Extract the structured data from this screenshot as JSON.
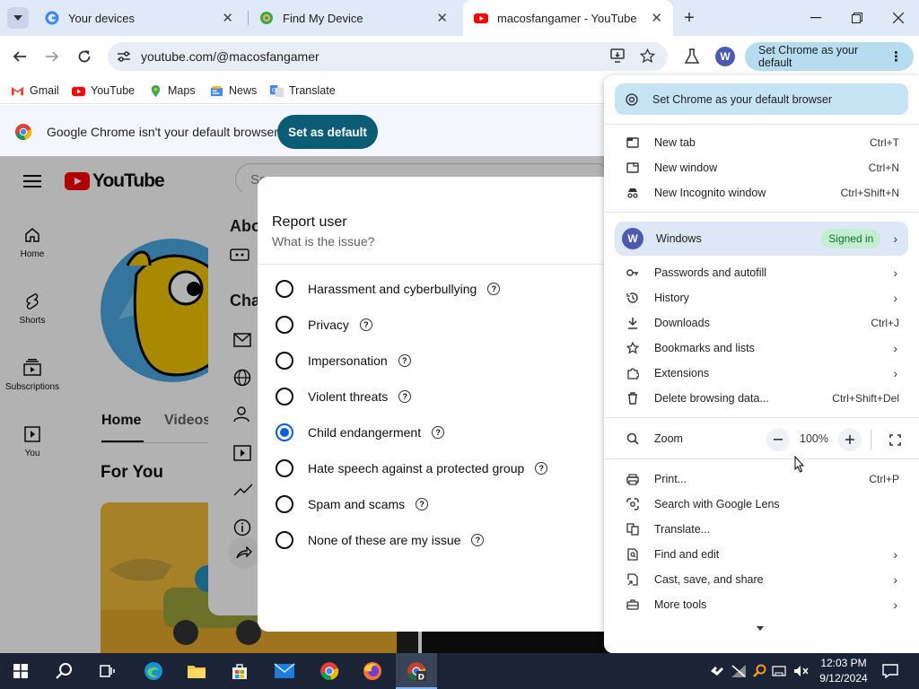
{
  "tabs": [
    {
      "title": "Your devices",
      "favicon": "google-g-icon"
    },
    {
      "title": "Find My Device",
      "favicon": "find-my-device-icon"
    },
    {
      "title": "macosfangamer - YouTube",
      "favicon": "youtube-icon",
      "active": true
    }
  ],
  "omnibox": {
    "url": "youtube.com/@macosfangamer"
  },
  "profile": {
    "initial": "W"
  },
  "default_button": {
    "label": "Set Chrome as your default"
  },
  "bookmarks": [
    "Gmail",
    "YouTube",
    "Maps",
    "News",
    "Translate"
  ],
  "infobar": {
    "text": "Google Chrome isn't your default browser",
    "button": "Set as default"
  },
  "youtube": {
    "logo_text": "YouTube",
    "search_placeholder": "Se",
    "sidebar": [
      "Home",
      "Shorts",
      "Subscriptions",
      "You"
    ],
    "tabs": [
      "Home",
      "Videos"
    ],
    "section_title": "For You",
    "about_heading": "Abo",
    "channel_heading": "Cha"
  },
  "report_dialog": {
    "title": "Report user",
    "subtitle": "What is the issue?",
    "options": [
      {
        "label": "Harassment and cyberbullying",
        "selected": false
      },
      {
        "label": "Privacy",
        "selected": false
      },
      {
        "label": "Impersonation",
        "selected": false
      },
      {
        "label": "Violent threats",
        "selected": false
      },
      {
        "label": "Child endangerment",
        "selected": true
      },
      {
        "label": "Hate speech against a protected group",
        "selected": false
      },
      {
        "label": "Spam and scams",
        "selected": false
      },
      {
        "label": "None of these are my issue",
        "selected": false
      }
    ]
  },
  "chrome_menu": {
    "banner": "Set Chrome as your default browser",
    "group1": [
      {
        "label": "New tab",
        "shortcut": "Ctrl+T",
        "icon": "new-tab-icon"
      },
      {
        "label": "New window",
        "shortcut": "Ctrl+N",
        "icon": "new-window-icon"
      },
      {
        "label": "New Incognito window",
        "shortcut": "Ctrl+Shift+N",
        "icon": "incognito-icon"
      }
    ],
    "profile": {
      "initial": "W",
      "name": "Windows",
      "status": "Signed in"
    },
    "group2": [
      {
        "label": "Passwords and autofill",
        "shortcut": "",
        "arrow": true,
        "icon": "key-icon"
      },
      {
        "label": "History",
        "shortcut": "",
        "arrow": true,
        "icon": "history-icon"
      },
      {
        "label": "Downloads",
        "shortcut": "Ctrl+J",
        "arrow": false,
        "icon": "download-icon"
      },
      {
        "label": "Bookmarks and lists",
        "shortcut": "",
        "arrow": true,
        "icon": "star-icon"
      },
      {
        "label": "Extensions",
        "shortcut": "",
        "arrow": true,
        "icon": "extension-icon"
      },
      {
        "label": "Delete browsing data...",
        "shortcut": "Ctrl+Shift+Del",
        "arrow": false,
        "icon": "trash-icon"
      }
    ],
    "zoom": {
      "label": "Zoom",
      "value": "100%"
    },
    "group3": [
      {
        "label": "Print...",
        "shortcut": "Ctrl+P",
        "arrow": false,
        "icon": "print-icon"
      },
      {
        "label": "Search with Google Lens",
        "shortcut": "",
        "arrow": false,
        "icon": "lens-icon"
      },
      {
        "label": "Translate...",
        "shortcut": "",
        "arrow": false,
        "icon": "translate-icon"
      },
      {
        "label": "Find and edit",
        "shortcut": "",
        "arrow": true,
        "icon": "find-icon"
      },
      {
        "label": "Cast, save, and share",
        "shortcut": "",
        "arrow": true,
        "icon": "cast-icon"
      },
      {
        "label": "More tools",
        "shortcut": "",
        "arrow": true,
        "icon": "toolbox-icon"
      }
    ]
  },
  "taskbar": {
    "time": "12:03 PM",
    "date": "9/12/2024",
    "apps": [
      "search-icon",
      "task-view-icon",
      "edge-icon",
      "file-explorer-icon",
      "store-icon",
      "mail-icon",
      "chrome-icon",
      "firefox-icon",
      "chrome-dev-icon"
    ]
  },
  "colors": {
    "tabstrip": "#dfe9f8",
    "accent_teal": "#0b5c74",
    "radio_selected": "#065fd4",
    "taskbar": "#1b2436"
  }
}
